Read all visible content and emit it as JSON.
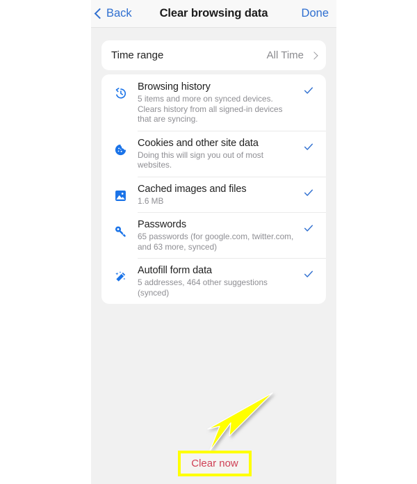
{
  "navbar": {
    "back_label": "Back",
    "title": "Clear browsing data",
    "done_label": "Done",
    "back_icon": "chevron-left-icon",
    "accent_color": "#2f6fd0"
  },
  "time_range": {
    "label": "Time range",
    "value": "All Time",
    "chevron_icon": "chevron-right-icon"
  },
  "options": [
    {
      "icon": "history-clock-icon",
      "title": "Browsing history",
      "subtitle": "5 items and more on synced devices. Clears history from all signed-in devices that are syncing.",
      "checked": true,
      "check_icon": "checkmark-icon"
    },
    {
      "icon": "cookie-icon",
      "title": "Cookies and other site data",
      "subtitle": "Doing this will sign you out of most websites.",
      "checked": true,
      "check_icon": "checkmark-icon"
    },
    {
      "icon": "image-icon",
      "title": "Cached images and files",
      "subtitle": "1.6 MB",
      "checked": true,
      "check_icon": "checkmark-icon"
    },
    {
      "icon": "key-icon",
      "title": "Passwords",
      "subtitle": "65 passwords (for google.com, twitter.com, and 63 more, synced)",
      "checked": true,
      "check_icon": "checkmark-icon"
    },
    {
      "icon": "magic-wand-icon",
      "title": "Autofill form data",
      "subtitle": "5 addresses, 464 other suggestions (synced)",
      "checked": true,
      "check_icon": "checkmark-icon"
    }
  ],
  "footer": {
    "clear_now_label": "Clear now",
    "clear_now_color": "#cf4055"
  },
  "annotation": {
    "highlight_color": "#ffff00",
    "arrow_icon": "arrow-pointing-down-left-icon"
  },
  "theme": {
    "page_background": "#f1f1f1",
    "card_background": "#ffffff",
    "icon_blue": "#1a73e8",
    "check_blue": "#2f6fd0",
    "subtitle_gray": "#8e8e93"
  }
}
